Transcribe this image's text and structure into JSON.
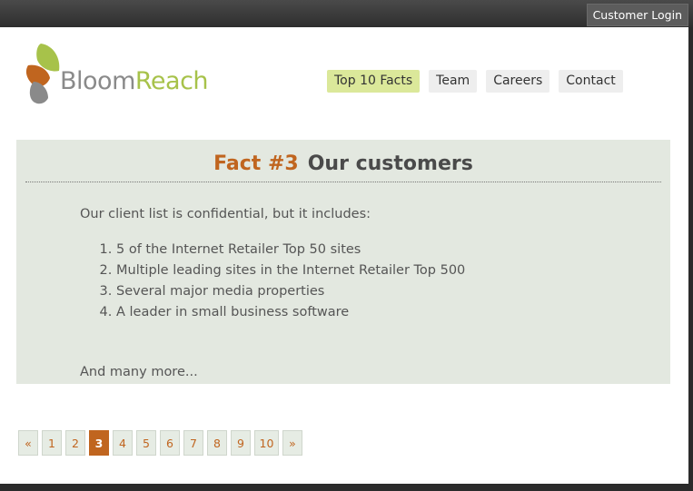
{
  "topbar": {
    "login_label": "Customer Login"
  },
  "logo": {
    "text_bloom": "Bloom",
    "text_reach": "Reach"
  },
  "nav": {
    "items": [
      {
        "label": "Top 10 Facts",
        "active": true
      },
      {
        "label": "Team"
      },
      {
        "label": "Careers"
      },
      {
        "label": "Contact"
      }
    ]
  },
  "content": {
    "fact_label": "Fact #3",
    "title": "Our customers",
    "intro": "Our client list is confidential, but it includes:",
    "facts": [
      "5 of the Internet Retailer Top 50 sites",
      "Multiple leading sites in the Internet Retailer Top 500",
      "Several major media properties",
      "A leader in small business software"
    ],
    "outro": "And many more..."
  },
  "pager": {
    "prev": "«",
    "pages": [
      "1",
      "2",
      "3",
      "4",
      "5",
      "6",
      "7",
      "8",
      "9",
      "10"
    ],
    "current": "3",
    "next": "»"
  },
  "colors": {
    "accent": "#c0651f",
    "brand_green": "#a7c24a",
    "panel": "#e3e8e0",
    "nav_active": "#dbe89a"
  }
}
